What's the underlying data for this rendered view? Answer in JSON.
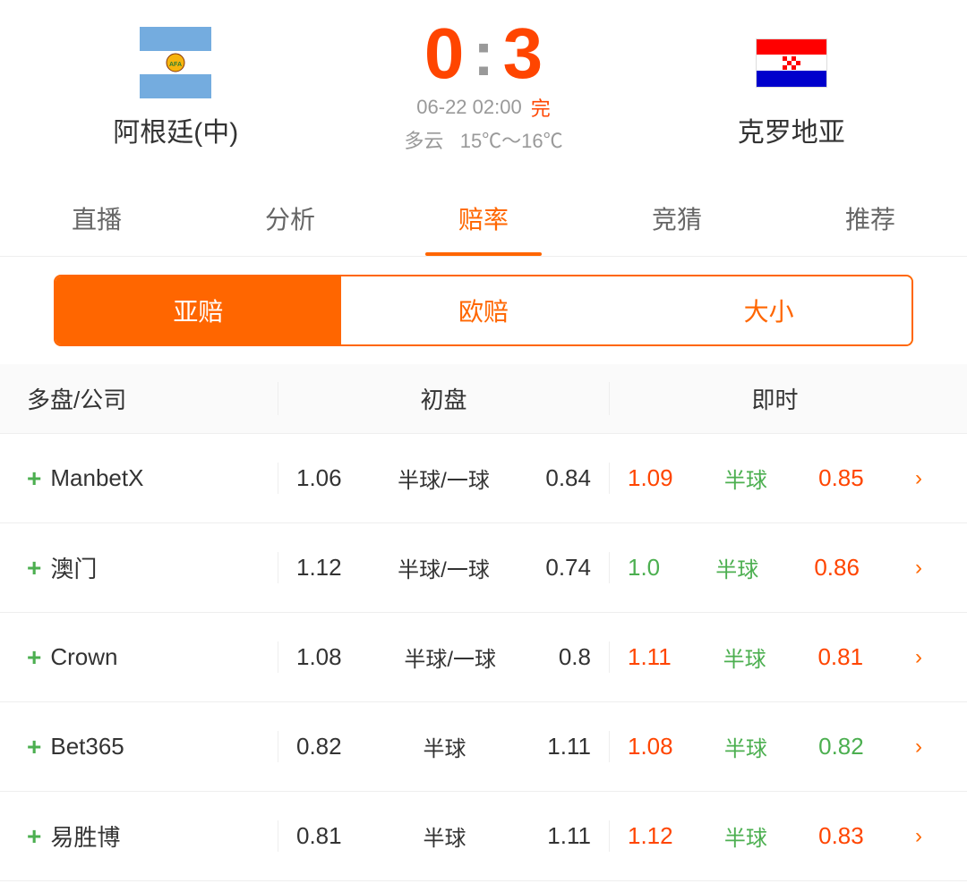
{
  "header": {
    "team_home": "阿根廷(中)",
    "team_away": "克罗地亚",
    "score_home": "0",
    "score_away": "3",
    "score_colon": ":",
    "match_date": "06-22 02:00",
    "match_status": "完",
    "weather": "多云",
    "temp": "15℃～16℃"
  },
  "tabs": {
    "items": [
      {
        "label": "直播",
        "active": false
      },
      {
        "label": "分析",
        "active": false
      },
      {
        "label": "赔率",
        "active": true
      },
      {
        "label": "竞猜",
        "active": false
      },
      {
        "label": "推荐",
        "active": false
      }
    ]
  },
  "sub_tabs": {
    "items": [
      {
        "label": "亚赔",
        "active": true
      },
      {
        "label": "欧赔",
        "active": false
      },
      {
        "label": "大小",
        "active": false
      }
    ]
  },
  "table": {
    "headers": {
      "company": "多盘/公司",
      "initial": "初盘",
      "live": "即时"
    },
    "rows": [
      {
        "company": "ManbetX",
        "initial_v1": "1.06",
        "initial_handicap": "半球/一球",
        "initial_v2": "0.84",
        "live_v1": "1.09",
        "live_handicap": "半球",
        "live_v2": "0.85",
        "live_v1_color": "red",
        "live_v2_color": "red"
      },
      {
        "company": "澳门",
        "initial_v1": "1.12",
        "initial_handicap": "半球/一球",
        "initial_v2": "0.74",
        "live_v1": "1.0",
        "live_handicap": "半球",
        "live_v2": "0.86",
        "live_v1_color": "green",
        "live_v2_color": "red"
      },
      {
        "company": "Crown",
        "initial_v1": "1.08",
        "initial_handicap": "半球/一球",
        "initial_v2": "0.8",
        "live_v1": "1.11",
        "live_handicap": "半球",
        "live_v2": "0.81",
        "live_v1_color": "red",
        "live_v2_color": "red"
      },
      {
        "company": "Bet365",
        "initial_v1": "0.82",
        "initial_handicap": "半球",
        "initial_v2": "1.11",
        "live_v1": "1.08",
        "live_handicap": "半球",
        "live_v2": "0.82",
        "live_v1_color": "red",
        "live_v2_color": "green"
      },
      {
        "company": "易胜博",
        "initial_v1": "0.81",
        "initial_handicap": "半球",
        "initial_v2": "1.11",
        "live_v1": "1.12",
        "live_handicap": "半球",
        "live_v2": "0.83",
        "live_v1_color": "red",
        "live_v2_color": "red"
      }
    ]
  },
  "icons": {
    "plus": "+",
    "arrow": "›"
  }
}
